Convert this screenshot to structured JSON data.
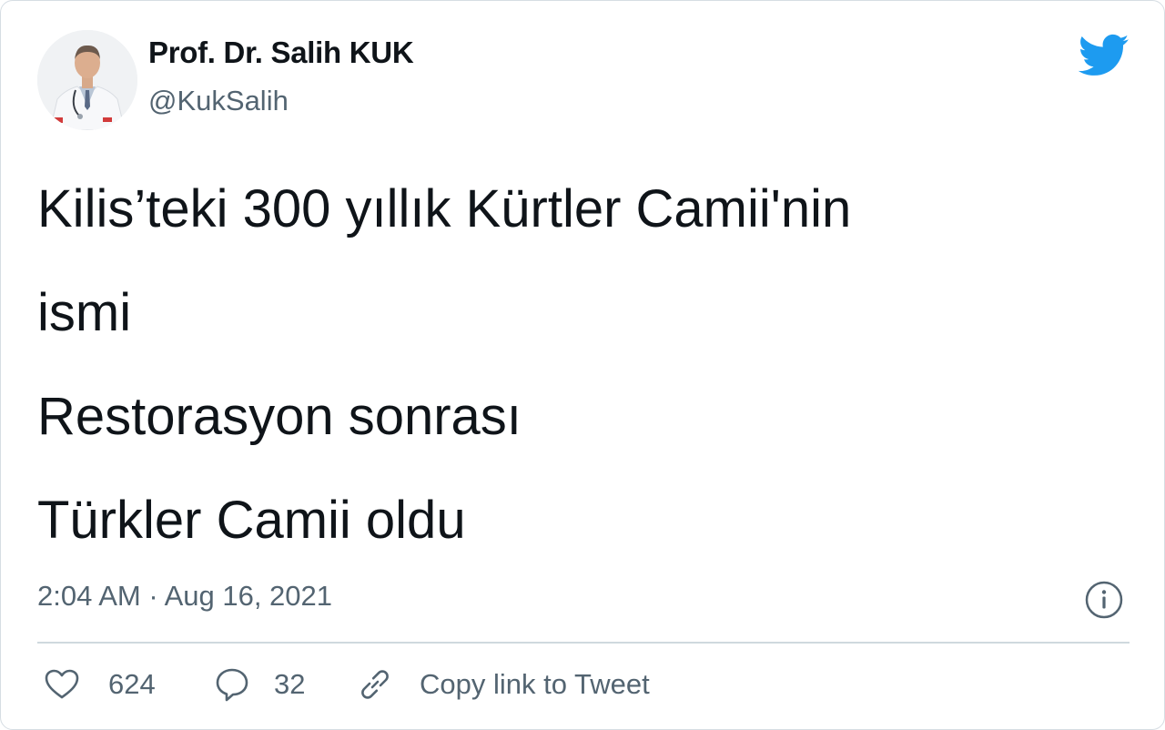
{
  "author": {
    "name": "Prof. Dr. Salih KUK",
    "handle": "@KukSalih",
    "avatar_icon": "profile-photo"
  },
  "brand": {
    "logo_icon": "twitter-bird-icon",
    "color": "#1d9bf0"
  },
  "tweet": {
    "lines": [
      "Kilis’teki 300 yıllık Kürtler Camii'nin",
      "ismi",
      "Restorasyon sonrası",
      "Türkler Camii oldu"
    ],
    "timestamp": "2:04 AM · Aug 16, 2021"
  },
  "actions": {
    "likes": "624",
    "replies": "32",
    "copy_link_label": "Copy link to Tweet"
  },
  "colors": {
    "text_primary": "#0f1419",
    "text_secondary": "#536471",
    "divider": "#cfd9de"
  }
}
